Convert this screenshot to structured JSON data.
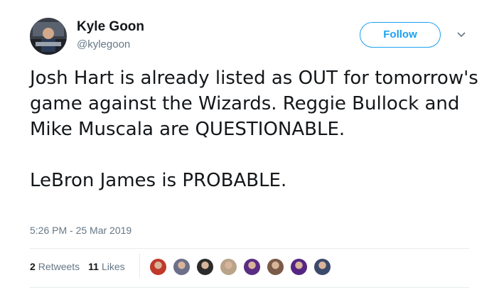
{
  "author": {
    "name": "Kyle Goon",
    "handle": "@kylegoon"
  },
  "follow_label": "Follow",
  "tweet": {
    "paragraph1": "Josh Hart is already listed as OUT for tomorrow's game against the Wizards. Reggie Bullock and Mike Muscala are QUESTIONABLE.",
    "paragraph2": "LeBron James is PROBABLE."
  },
  "timestamp": "5:26 PM - 25 Mar 2019",
  "stats": {
    "retweets_count": "2",
    "retweets_label": "Retweets",
    "likes_count": "11",
    "likes_label": "Likes"
  },
  "likers": [
    {
      "color": "#c0392b"
    },
    {
      "color": "#6b6f8a"
    },
    {
      "color": "#2b2b2b"
    },
    {
      "color": "#b9a48a"
    },
    {
      "color": "#5a2d82"
    },
    {
      "color": "#7a5a48"
    },
    {
      "color": "#552583"
    },
    {
      "color": "#3b4a6b"
    }
  ],
  "colors": {
    "accent": "#1da1f2",
    "text": "#14171a",
    "secondary": "#657786"
  },
  "icons": {
    "avatar": "profile-photo",
    "chevron": "chevron-down-icon"
  }
}
